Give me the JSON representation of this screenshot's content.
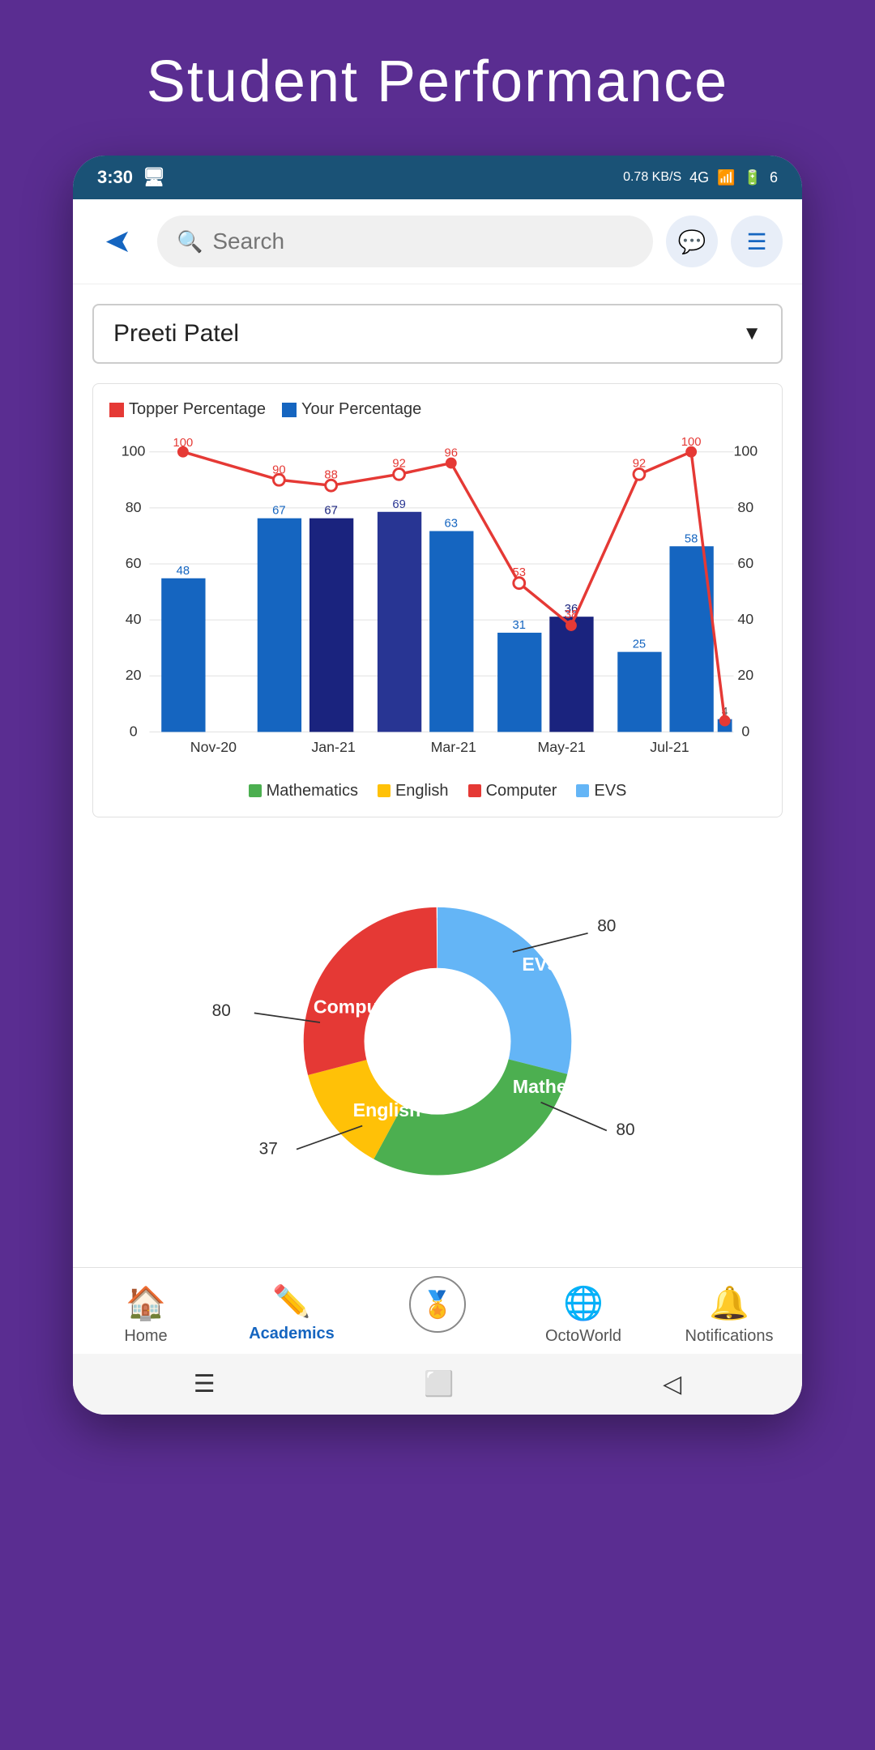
{
  "page": {
    "title": "Student Performance",
    "background_color": "#5a2d91"
  },
  "status_bar": {
    "time": "3:30",
    "network": "0.78 KB/S",
    "data_type": "4G",
    "battery": "6"
  },
  "top_bar": {
    "search_placeholder": "Search",
    "back_icon": "◀",
    "chat_icon": "💬",
    "menu_icon": "☰"
  },
  "dropdown": {
    "selected": "Preeti Patel",
    "arrow": "▼"
  },
  "chart": {
    "legend": [
      {
        "label": "Topper Percentage",
        "color": "#e53935"
      },
      {
        "label": "Your Percentage",
        "color": "#1565c0"
      }
    ],
    "months": [
      "Nov-20",
      "Jan-21",
      "Mar-21",
      "May-21",
      "Jul-21"
    ],
    "bars": [
      {
        "month": "Nov-20",
        "value": 48,
        "topper": 100
      },
      {
        "month": "Jan-21",
        "value": 67,
        "topper": 90
      },
      {
        "month": "Jan-21b",
        "value": 67,
        "topper": 88
      },
      {
        "month": "Mar-21a",
        "value": 69,
        "topper": 92
      },
      {
        "month": "Mar-21b",
        "value": 63,
        "topper": 96
      },
      {
        "month": "May-21a",
        "value": 31,
        "topper": 53
      },
      {
        "month": "May-21b",
        "value": 36,
        "topper": 38
      },
      {
        "month": "Jul-21a",
        "value": 25,
        "topper": 92
      },
      {
        "month": "Jul-21b",
        "value": 58,
        "topper": 100
      },
      {
        "month": "Jul-21c",
        "value": 4,
        "topper": 4
      }
    ],
    "subject_legend": [
      {
        "label": "Mathematics",
        "color": "#4caf50"
      },
      {
        "label": "English",
        "color": "#ffc107"
      },
      {
        "label": "Computer",
        "color": "#e53935"
      },
      {
        "label": "EVS",
        "color": "#64b5f6"
      }
    ]
  },
  "donut": {
    "segments": [
      {
        "label": "EVS",
        "color": "#64b5f6",
        "value": 80,
        "percentage": 29
      },
      {
        "label": "Mathematics",
        "color": "#4caf50",
        "value": 80,
        "percentage": 29
      },
      {
        "label": "English",
        "color": "#ffc107",
        "value": 37,
        "percentage": 13
      },
      {
        "label": "Computer",
        "color": "#e53935",
        "value": 80,
        "percentage": 29
      }
    ],
    "labels": {
      "evs_value": "80",
      "math_value": "80",
      "english_value": "37",
      "computer_value": "80"
    }
  },
  "bottom_nav": {
    "items": [
      {
        "label": "Home",
        "icon": "🏠",
        "active": false
      },
      {
        "label": "Academics",
        "icon": "✏️",
        "active": true
      },
      {
        "label": "",
        "icon": "🎖️",
        "active": false,
        "is_center": true
      },
      {
        "label": "OctoWorld",
        "icon": "🌐",
        "active": false
      },
      {
        "label": "Notifications",
        "icon": "🔔",
        "active": false
      }
    ]
  },
  "system_nav": {
    "menu": "☰",
    "home": "⬜",
    "back": "◁"
  }
}
